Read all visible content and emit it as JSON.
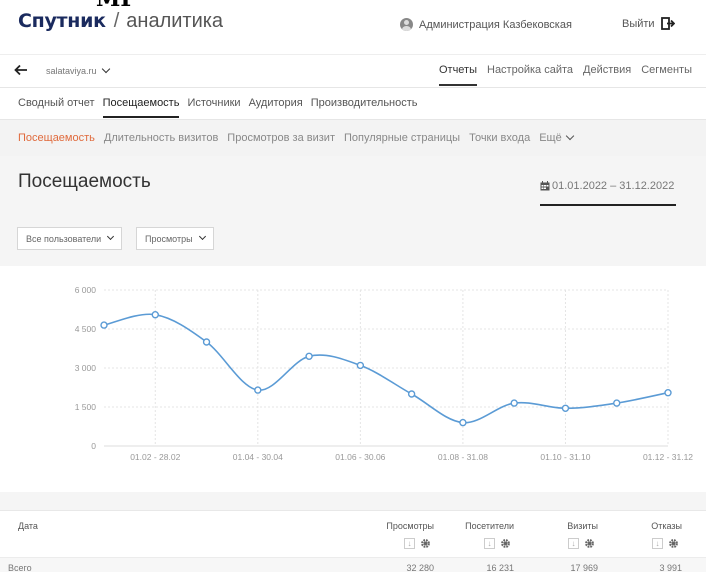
{
  "header": {
    "cut_glyph": "МГ",
    "logo_brand": "Спутник",
    "logo_sep": "/",
    "logo_section": "аналитика",
    "user_name": "Администрация Казбековская",
    "logout_label": "Выйти"
  },
  "site_bar": {
    "site": "salataviya.ru",
    "tabs": [
      {
        "label": "Отчеты",
        "active": true
      },
      {
        "label": "Настройка сайта",
        "active": false
      },
      {
        "label": "Действия",
        "active": false
      },
      {
        "label": "Сегменты",
        "active": false
      }
    ]
  },
  "report_tabs": [
    {
      "label": "Сводный отчет",
      "active": false
    },
    {
      "label": "Посещаемость",
      "active": true
    },
    {
      "label": "Источники",
      "active": false
    },
    {
      "label": "Аудитория",
      "active": false
    },
    {
      "label": "Производительность",
      "active": false
    }
  ],
  "sub_tabs": [
    {
      "label": "Посещаемость",
      "active": true
    },
    {
      "label": "Длительность визитов",
      "active": false
    },
    {
      "label": "Просмотров за визит",
      "active": false
    },
    {
      "label": "Популярные страницы",
      "active": false
    },
    {
      "label": "Точки входа",
      "active": false
    },
    {
      "label": "Ещё",
      "active": false
    }
  ],
  "page": {
    "title": "Посещаемость",
    "date_range": "01.01.2022 – 31.12.2022"
  },
  "filters": {
    "users": "Все пользователи",
    "metric": "Просмотры"
  },
  "colors": {
    "accent": "#e06a3c",
    "line": "#5b9bd5",
    "brand": "#1a2a5e"
  },
  "chart_data": {
    "type": "line",
    "y_ticks": [
      "0",
      "1 500",
      "3 000",
      "4 500",
      "6 000"
    ],
    "x_tick_labels": [
      "01.02 - 28.02",
      "01.04 - 30.04",
      "01.06 - 30.06",
      "01.08 - 31.08",
      "01.10 - 31.10",
      "01.12 - 31.12"
    ],
    "ylim": [
      0,
      6000
    ],
    "x": [
      1,
      2,
      3,
      4,
      5,
      6,
      7,
      8,
      9,
      10,
      11,
      12
    ],
    "values": [
      4650,
      5050,
      4000,
      2150,
      3450,
      3100,
      2000,
      900,
      1650,
      1450,
      1650,
      2050
    ],
    "grid": true
  },
  "table": {
    "headers": [
      "Дата",
      "Просмотры",
      "Посетители",
      "Визиты",
      "Отказы"
    ],
    "sort_symbol": "↓",
    "total_label": "Всего",
    "totals": [
      "32 280",
      "16 231",
      "17 969",
      "3 991"
    ]
  }
}
